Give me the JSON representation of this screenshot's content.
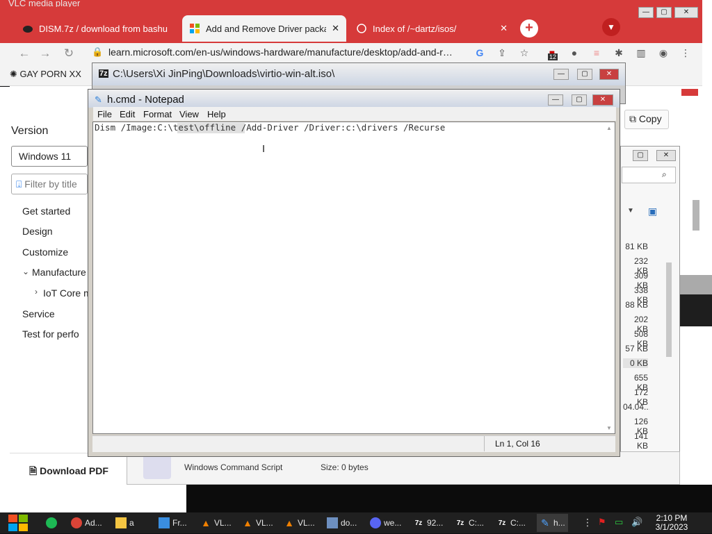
{
  "background_app": {
    "vlc_title": "VLC media player"
  },
  "browser": {
    "tabs": [
      {
        "label": "DISM.7z / download from bashu",
        "active": false
      },
      {
        "label": "Add and Remove Driver packag",
        "active": true
      },
      {
        "label": "Index of /~dartz/isos/",
        "active": false
      }
    ],
    "new_tab": "+",
    "address": "learn.microsoft.com/en-us/windows-hardware/manufacture/desktop/add-and-r…",
    "extension_badge": "12",
    "bookmark": "GAY PORN XX",
    "page": {
      "version_heading": "Version",
      "version_select": "Windows 11",
      "filter_placeholder": "Filter by title",
      "nav": [
        "Get started",
        "Design",
        "Customize",
        "Manufacture",
        "IoT Core m",
        "Service",
        "Test for perfo"
      ],
      "download_pdf": "Download PDF",
      "copy_button": "Copy"
    }
  },
  "explorer": {
    "title": "C:\\Users\\Xi JinPing\\Downloads\\virtio-win-alt.iso\\",
    "sizes": [
      "81 KB",
      "232 KB",
      "309 KB",
      "338 KB",
      "88 KB",
      "202 KB",
      "508 KB",
      "57 KB",
      "0 KB",
      "655 KB",
      "172 KB",
      "04.04...",
      "126 KB",
      "141 KB"
    ],
    "details": {
      "name": "h.cmd",
      "type": "Windows Command Script",
      "size": "Size: 0 bytes"
    }
  },
  "notepad": {
    "title": "h.cmd - Notepad",
    "menu": [
      "File",
      "Edit",
      "Format",
      "View",
      "Help"
    ],
    "content": "Dism /Image:C:\\test\\offline /Add-Driver /Driver:c:\\drivers /Recurse",
    "status": "Ln 1, Col 16"
  },
  "taskbar": {
    "items": [
      "Ad...",
      "a",
      "Fr...",
      "VL...",
      "VL...",
      "VL...",
      "do...",
      "we...",
      "92...",
      "C:...",
      "C:...",
      "h..."
    ],
    "time": "2:10 PM",
    "date": "3/1/2023"
  },
  "colors": {
    "chrome_red": "#d63a3a",
    "taskbar": "#202020",
    "notepad_frame": "#d4d0c8"
  }
}
